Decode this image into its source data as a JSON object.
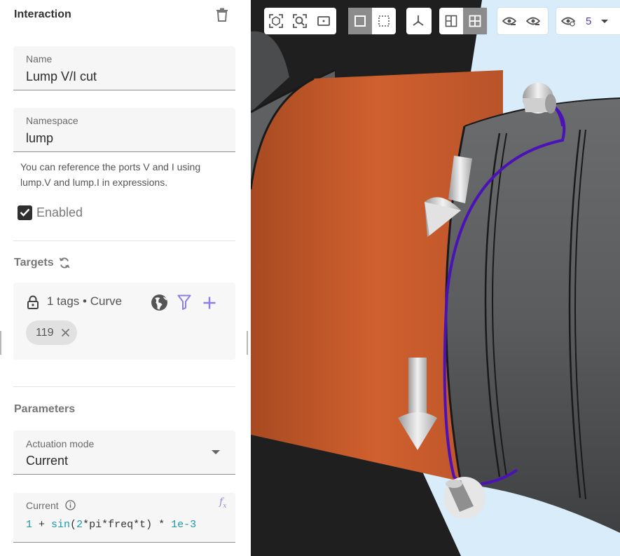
{
  "panel": {
    "title": "Interaction",
    "name_field": {
      "label": "Name",
      "value": "Lump V/I cut"
    },
    "namespace_field": {
      "label": "Namespace",
      "value": "lump"
    },
    "help_line1": "You can reference the ports V and I using",
    "help_line2": "lump.V and lump.I in expressions.",
    "enabled_label": "Enabled",
    "enabled_checked": true,
    "targets": {
      "title": "Targets",
      "summary": "1 tags • Curve",
      "chips": [
        "119"
      ]
    },
    "parameters": {
      "title": "Parameters",
      "actuation_mode": {
        "label": "Actuation mode",
        "value": "Current"
      },
      "current": {
        "label": "Current",
        "expr_parts": [
          "1",
          " + ",
          "sin",
          "(",
          "2",
          "*pi*freq*t) * ",
          "1e-3"
        ]
      }
    }
  },
  "viewport": {
    "visibility_level": "5",
    "colors": {
      "background": "#1f1f1f",
      "sky": "#d8ecfa",
      "copper": "#c85a2a",
      "grey_cylinder": "#5a5c5e",
      "curve": "#4b12b8",
      "arrow": "#d9d9d9"
    },
    "toolbar_icons": [
      "fit-view-icon",
      "zoom-icon",
      "frame-icon",
      "solid-view-icon",
      "wire-view-icon",
      "axes-icon",
      "split-view-icon",
      "grid-view-icon",
      "hide-icon",
      "show-icon",
      "visibility-level-icon"
    ]
  }
}
